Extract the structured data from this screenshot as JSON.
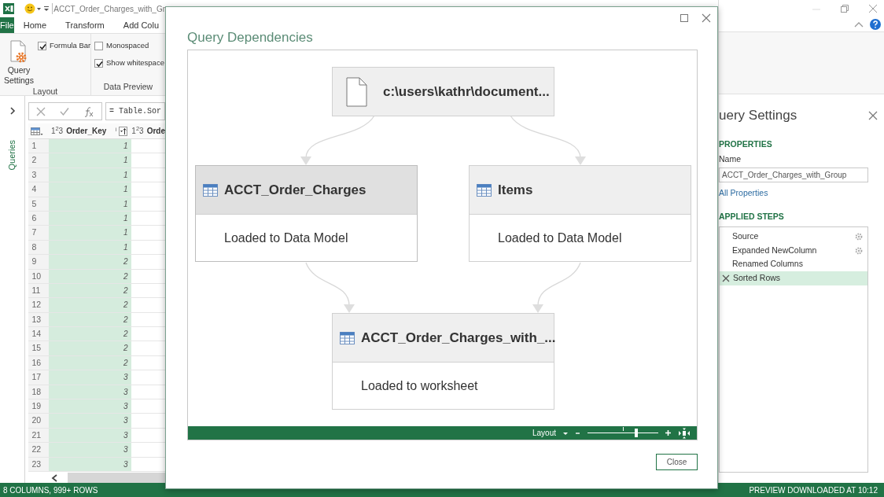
{
  "app": {
    "title": "ACCT_Order_Charges_with_Gr"
  },
  "ribbon_tabs": [
    {
      "label": "File",
      "kind": "file"
    },
    {
      "label": "Home",
      "kind": "tab"
    },
    {
      "label": "Transform",
      "kind": "tab"
    },
    {
      "label": "Add Colu",
      "kind": "tab"
    }
  ],
  "ribbon": {
    "query_settings_label": "Query Settings",
    "layout_group": "Layout",
    "data_preview_group": "Data Preview",
    "layout_options": [
      {
        "label": "Formula Bar",
        "checked": true
      }
    ],
    "data_preview_options": [
      {
        "label": "Monospaced",
        "checked": false
      },
      {
        "label": "Show whitespace",
        "checked": true
      }
    ]
  },
  "queries_pane": {
    "label": "Queries"
  },
  "formula_bar": {
    "formula": "= Table.Sor"
  },
  "grid": {
    "columns": [
      {
        "type": "1$^{2}$3",
        "name": "Order_Key",
        "sorted": true
      },
      {
        "type": "1$^{2}$3",
        "name": "Orde",
        "sorted": false
      }
    ],
    "rows": [
      {
        "number": "1",
        "value": "1"
      },
      {
        "number": "2",
        "value": "1"
      },
      {
        "number": "3",
        "value": "1"
      },
      {
        "number": "4",
        "value": "1"
      },
      {
        "number": "5",
        "value": "1"
      },
      {
        "number": "6",
        "value": "1"
      },
      {
        "number": "7",
        "value": "1"
      },
      {
        "number": "8",
        "value": "1"
      },
      {
        "number": "9",
        "value": "2"
      },
      {
        "number": "10",
        "value": "2"
      },
      {
        "number": "11",
        "value": "2"
      },
      {
        "number": "12",
        "value": "2"
      },
      {
        "number": "13",
        "value": "2"
      },
      {
        "number": "14",
        "value": "2"
      },
      {
        "number": "15",
        "value": "2"
      },
      {
        "number": "16",
        "value": "2"
      },
      {
        "number": "17",
        "value": "3"
      },
      {
        "number": "18",
        "value": "3"
      },
      {
        "number": "19",
        "value": "3"
      },
      {
        "number": "20",
        "value": "3"
      },
      {
        "number": "21",
        "value": "3"
      },
      {
        "number": "22",
        "value": "3"
      },
      {
        "number": "23",
        "value": "3"
      }
    ]
  },
  "query_settings": {
    "title": "uery Settings",
    "properties_heading": "PROPERTIES",
    "name_label": "Name",
    "name_value": "ACCT_Order_Charges_with_Group",
    "all_properties": "All Properties",
    "steps_heading": "APPLIED STEPS",
    "steps": [
      {
        "label": "Source",
        "has_settings": true,
        "selected": false
      },
      {
        "label": "Expanded NewColumn",
        "has_settings": true,
        "selected": false
      },
      {
        "label": "Renamed Columns",
        "has_settings": false,
        "selected": false
      },
      {
        "label": "Sorted Rows",
        "has_settings": false,
        "selected": true
      }
    ]
  },
  "status_bar": {
    "left": "8 COLUMNS, 999+ ROWS",
    "right": "PREVIEW DOWNLOADED AT 10:12"
  },
  "dialog": {
    "title": "Query Dependencies",
    "nodes": [
      {
        "kind": "file",
        "label": "c:\\users\\kathr\\document...",
        "selected": false
      },
      {
        "kind": "table",
        "label": "ACCT_Order_Charges",
        "status": "Loaded to Data Model",
        "selected": true
      },
      {
        "kind": "table",
        "label": "Items",
        "status": "Loaded to Data Model",
        "selected": false
      },
      {
        "kind": "table",
        "label": "ACCT_Order_Charges_with_...",
        "status": "Loaded to worksheet",
        "selected": false
      }
    ],
    "layout_label": "Layout",
    "zoom": {
      "level": 0.69
    },
    "close_button": "Close"
  }
}
